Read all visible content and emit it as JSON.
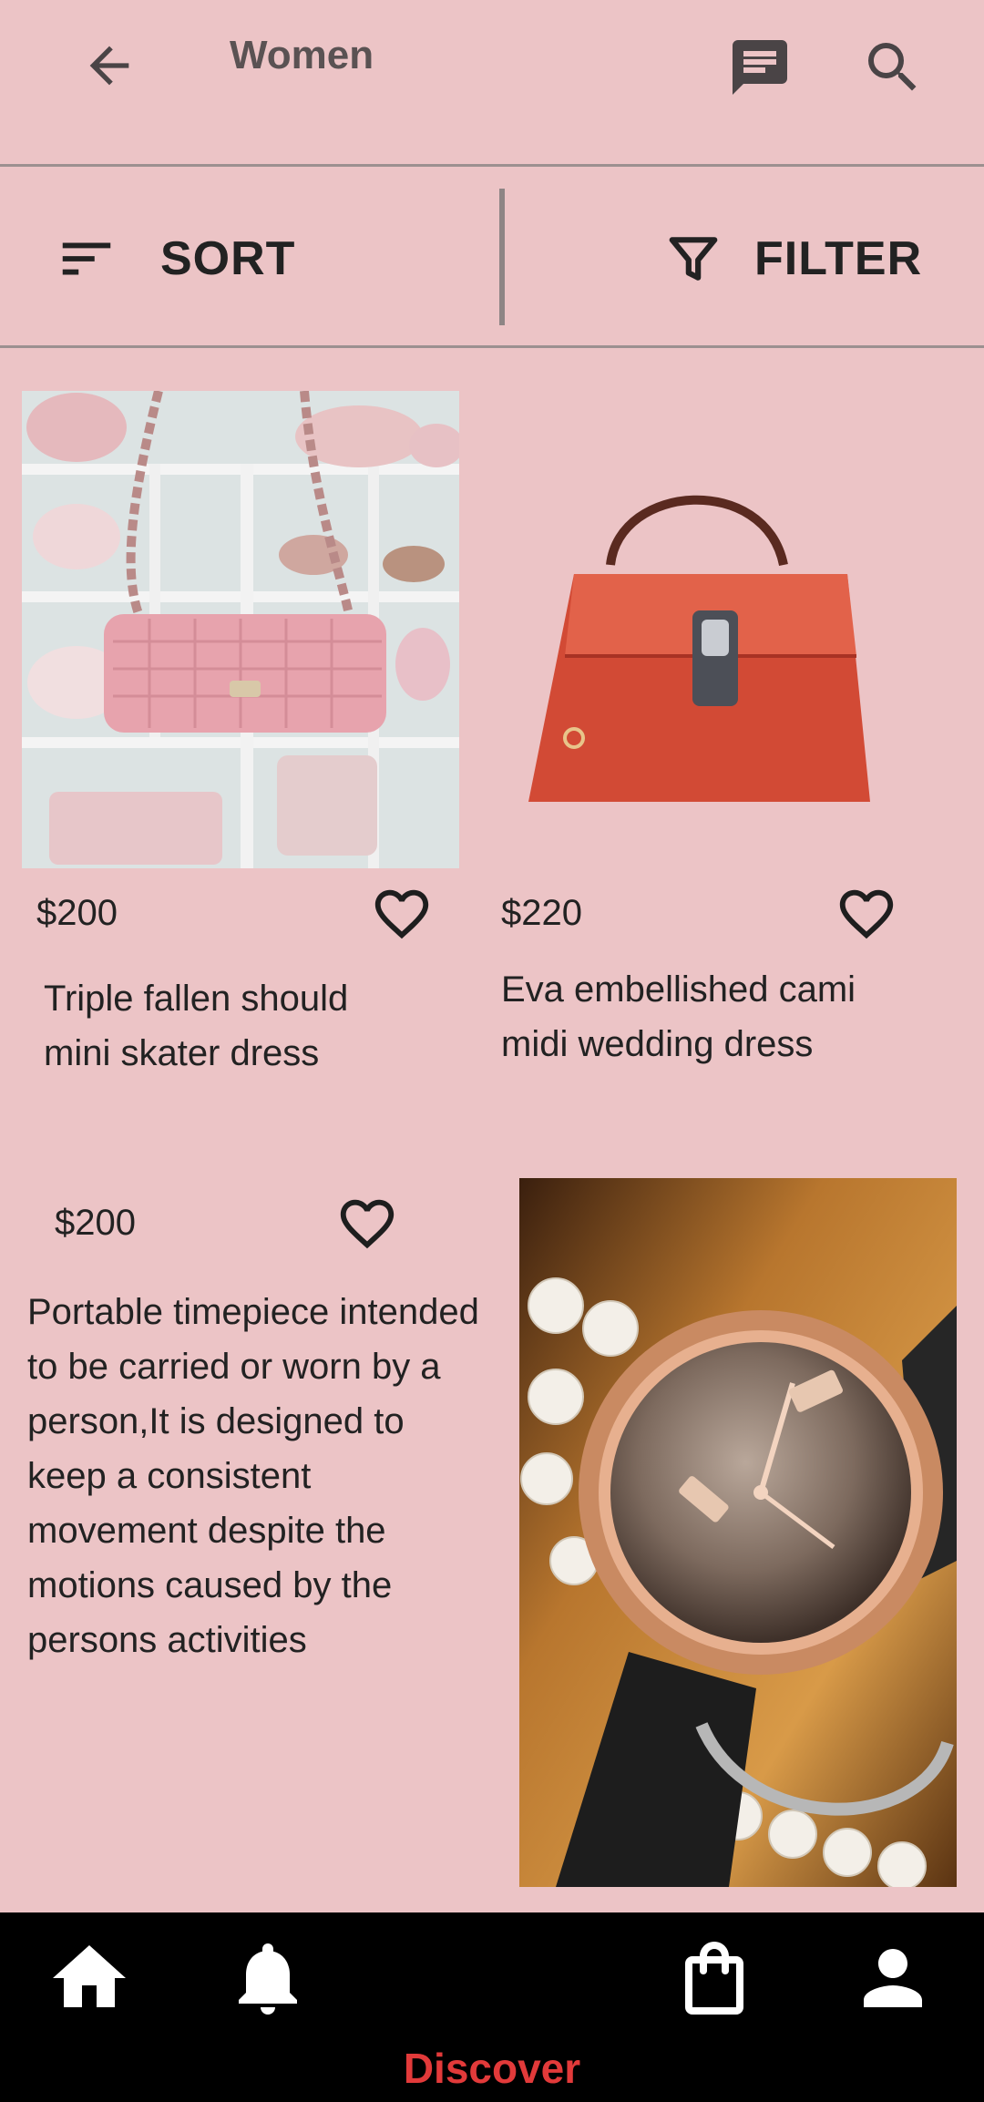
{
  "appbar": {
    "title": "Women",
    "back_icon": "arrow-back-icon",
    "chat_icon": "chat-icon",
    "search_icon": "search-icon"
  },
  "toolbar": {
    "sort_label": "SORT",
    "filter_label": "FILTER"
  },
  "products": [
    {
      "price": "$200",
      "name": "Triple fallen should mini skater dress",
      "image": "pink quilted chain handbag on shelf"
    },
    {
      "price": "$220",
      "name": "Eva embellished cami midi wedding dress",
      "image": "red leather top-handle handbag"
    },
    {
      "price": "$200",
      "name": "Portable timepiece intended to be carried or worn by a person,It is designed to keep a consistent movement despite the motions caused by the persons activities",
      "image": "rose gold wristwatch with pearls"
    }
  ],
  "bottom_nav": {
    "items": [
      "home-icon",
      "notifications-icon",
      "shopping-bag-icon",
      "person-icon"
    ],
    "active_label": "Discover",
    "accent": "#e23a3a"
  },
  "colors": {
    "background": "#ecc4c6",
    "nav_background": "#000000"
  }
}
